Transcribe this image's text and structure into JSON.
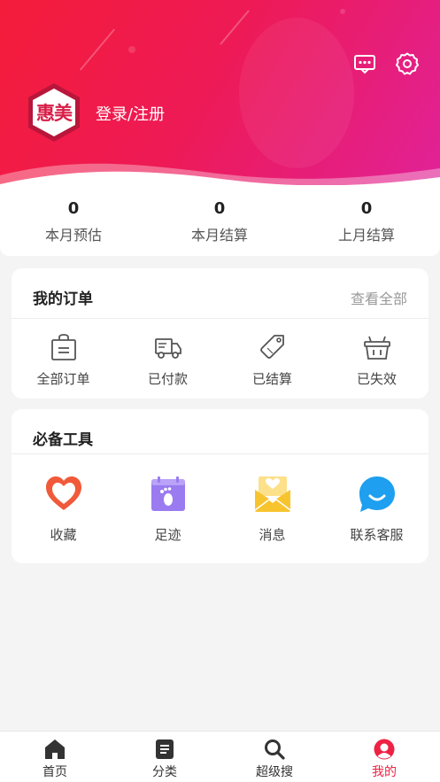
{
  "header": {
    "login_label": "登录/注册",
    "logo_text": "惠美",
    "message_icon": "message-icon",
    "settings_icon": "gear-icon",
    "gradient_colors": [
      "#f41c3a",
      "#e0229a"
    ]
  },
  "stats": [
    {
      "value": "0",
      "label": "本月预估"
    },
    {
      "value": "0",
      "label": "本月结算"
    },
    {
      "value": "0",
      "label": "上月结算"
    }
  ],
  "orders": {
    "title": "我的订单",
    "more_label": "查看全部",
    "items": [
      {
        "label": "全部订单",
        "icon": "shopping-bag-icon"
      },
      {
        "label": "已付款",
        "icon": "delivery-truck-icon"
      },
      {
        "label": "已结算",
        "icon": "price-tag-icon"
      },
      {
        "label": "已失效",
        "icon": "basket-icon"
      }
    ]
  },
  "tools": {
    "title": "必备工具",
    "items": [
      {
        "label": "收藏",
        "icon": "heart-icon",
        "color": "#f05a3a"
      },
      {
        "label": "足迹",
        "icon": "footprint-icon",
        "color": "#9a7bf0"
      },
      {
        "label": "消息",
        "icon": "envelope-icon",
        "color": "#f8c42e"
      },
      {
        "label": "联系客服",
        "icon": "chat-bubble-icon",
        "color": "#1e9fef"
      }
    ]
  },
  "tabbar": {
    "active_color": "#ee2244",
    "items": [
      {
        "label": "首页",
        "icon": "home-icon"
      },
      {
        "label": "分类",
        "icon": "list-icon"
      },
      {
        "label": "超级搜",
        "icon": "search-icon"
      },
      {
        "label": "我的",
        "icon": "profile-icon"
      }
    ]
  }
}
